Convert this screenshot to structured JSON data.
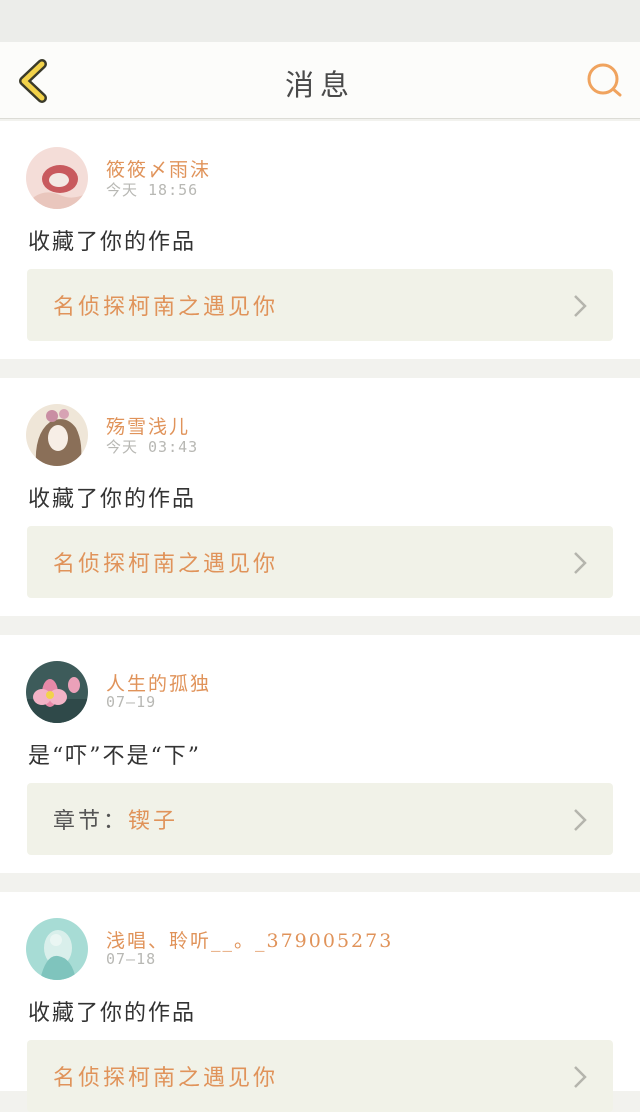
{
  "header": {
    "title": "消息",
    "back_icon": "chevron-left-icon",
    "search_icon": "search-icon"
  },
  "colors": {
    "accent": "#e0935a",
    "back": "#f2d24a",
    "link_bg": "#f1f2e8"
  },
  "messages": [
    {
      "username": "筱筱〆雨沫",
      "time": "今天 18:56",
      "text": "收藏了你的作品",
      "link_prefix": "",
      "link_text": "名侦探柯南之遇见你"
    },
    {
      "username": "殇雪浅儿",
      "time": "今天 03:43",
      "text": "收藏了你的作品",
      "link_prefix": "",
      "link_text": "名侦探柯南之遇见你"
    },
    {
      "username": "人生的孤独",
      "time": "07—19",
      "text": "是“吓”不是“下”",
      "link_prefix": "章节：",
      "link_text": "锲子"
    },
    {
      "username": "浅唱、聆听__。_379005273",
      "time": "07—18",
      "text": "收藏了你的作品",
      "link_prefix": "",
      "link_text": "名侦探柯南之遇见你"
    }
  ]
}
